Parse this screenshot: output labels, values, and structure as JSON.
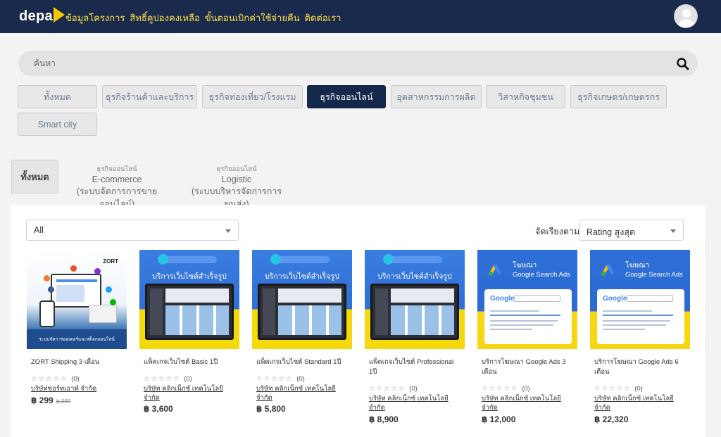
{
  "header": {
    "logo_text": "depa",
    "nav": [
      "ข้อมูลโครงการ",
      "สิทธิ์คูปองคงเหลือ",
      "ขั้นตอนเบิกค่าใช้จ่ายคืน",
      "ติดต่อเรา"
    ]
  },
  "search": {
    "placeholder": "ค้นหา"
  },
  "categories": [
    {
      "label": "ทั้งหมด"
    },
    {
      "label": "ธุรกิจร้านค้าและบริการ"
    },
    {
      "label": "ธุรกิจท่องเที่ยว/โรงแรม"
    },
    {
      "label": "ธุรกิจออนไลน์",
      "active": true
    },
    {
      "label": "อุตสาหกรรมการผลิต"
    },
    {
      "label": "วิสาหกิจชุมชน"
    },
    {
      "label": "ธุรกิจเกษตร/เกษตรกร"
    },
    {
      "label": "Smart city"
    }
  ],
  "subtabs": {
    "all": "ทั้งหมด",
    "items": [
      {
        "small": "ธุรกิจออนไลน์",
        "main": "E-commerce",
        "desc": "(ระบบจัดการการขายออนไลน์)"
      },
      {
        "small": "ธุรกิจออนไลน์",
        "main": "Logistic",
        "desc": "(ระบบบริหารจัดการการขนส่ง)"
      }
    ]
  },
  "filter": {
    "value": "All"
  },
  "sort": {
    "label": "จัดเรียงตาม",
    "value": "Rating สูงสุด"
  },
  "products": [
    {
      "name": "ZORT Shipping 3 เดือน",
      "stars": "☆☆☆☆☆",
      "count": "(0)",
      "shop": "บริษัทซอร์ทเอาท์ จำกัด",
      "price": "฿ 299",
      "old_price": "฿ 299",
      "thumb_brand": "ZORT",
      "thumb_caption": "ระบบจัดการออเดอร์และสต็อกออนไลน์"
    },
    {
      "name": "แพ็คเกจเว็บไซต์ Basic 1ปี",
      "stars": "☆☆☆☆☆",
      "count": "(0)",
      "shop": "บริษัท คลิกเน็กซ์ เทคโนโลยี จำกัด",
      "price": "฿ 3,600",
      "thumb_title": "บริการเว็บไซต์สำเร็จรูป"
    },
    {
      "name": "แพ็คเกจเว็บไซต์ Standard 1ปี",
      "stars": "☆☆☆☆☆",
      "count": "(0)",
      "shop": "บริษัท คลิกเน็กซ์ เทคโนโลยี จำกัด",
      "price": "฿ 5,800",
      "thumb_title": "บริการเว็บไซต์สำเร็จรูป"
    },
    {
      "name": "แพ็คเกจเว็บไซต์ Professional 1ปี",
      "stars": "☆☆☆☆☆",
      "count": "(0)",
      "shop": "บริษัท คลิกเน็กซ์ เทคโนโลยี จำกัด",
      "price": "฿ 8,900",
      "thumb_title": "บริการเว็บไซต์สำเร็จรูป"
    },
    {
      "name": "บริการโฆษณา Google Ads 3 เดือน",
      "stars": "☆☆☆☆☆",
      "count": "(0)",
      "shop": "บริษัท คลิกเน็กซ์ เทคโนโลยี จำกัด",
      "price": "฿ 12,000",
      "thumb_title": "โฆษณา",
      "thumb_sub": "Google Search Ads",
      "thumb_google": "Google"
    },
    {
      "name": "บริการโฆษณา Google Ads 6 เดือน",
      "stars": "☆☆☆☆☆",
      "count": "(0)",
      "shop": "บริษัท คลิกเน็กซ์ เทคโนโลยี จำกัด",
      "price": "฿ 22,320",
      "thumb_title": "โฆษณา",
      "thumb_sub": "Google Search Ads",
      "thumb_google": "Google"
    }
  ],
  "colors": {
    "header_bg": "#1a2a4c",
    "nav_text": "#ffe14a",
    "active_tab": "#14284b",
    "logo_arrow": "#f5c800"
  }
}
